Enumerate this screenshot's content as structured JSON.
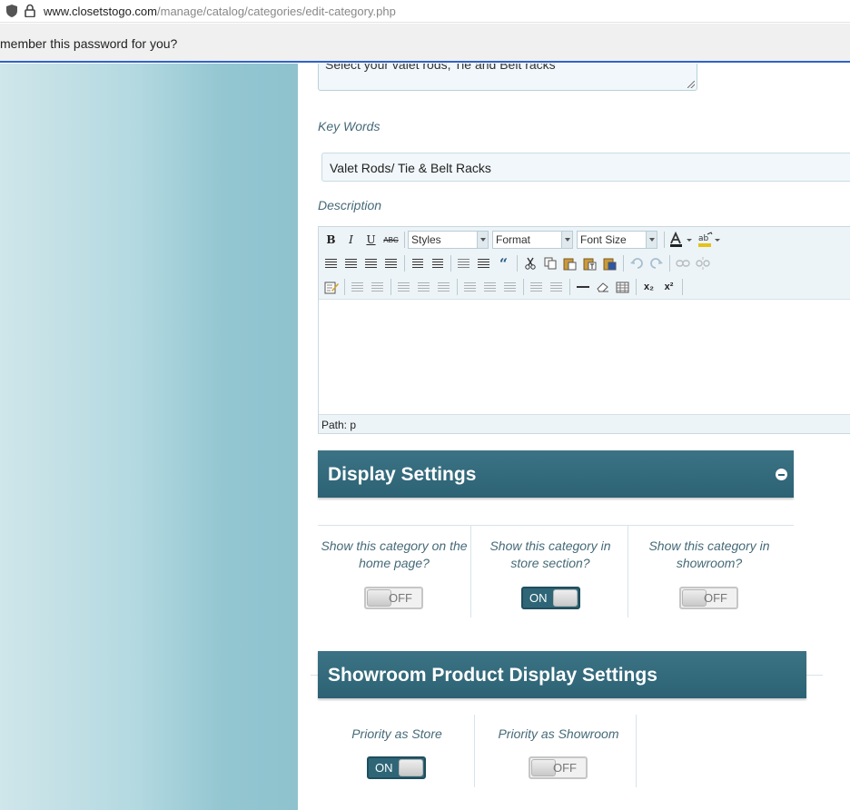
{
  "browser": {
    "url_host": "www.closetstogo.com",
    "url_path": "/manage/catalog/categories/edit-category.php",
    "password_prompt": "member this password for you?"
  },
  "form": {
    "meta_description_value": "Select your valet rods, Tie and Belt racks",
    "keywords_label": "Key Words",
    "keywords_value": "Valet Rods/ Tie & Belt Racks",
    "description_label": "Description",
    "editor": {
      "styles_combo": "Styles",
      "format_combo": "Format",
      "fontsize_combo": "Font Size",
      "bold": "B",
      "italic": "I",
      "underline": "U",
      "strike": "ABC",
      "blockquote": "“",
      "subscript": "x₂",
      "superscript": "x²",
      "path": "Path: p"
    }
  },
  "display_settings": {
    "title": "Display Settings",
    "columns": [
      {
        "label": "Show this category on the home page?",
        "state": "OFF"
      },
      {
        "label": "Show this category in store section?",
        "state": "ON"
      },
      {
        "label": "Show this category in showroom?",
        "state": "OFF"
      }
    ]
  },
  "showroom_settings": {
    "title": "Showroom Product Display Settings",
    "columns": [
      {
        "label": "Priority as Store",
        "state": "ON"
      },
      {
        "label": "Priority as Showroom",
        "state": "OFF"
      }
    ]
  }
}
